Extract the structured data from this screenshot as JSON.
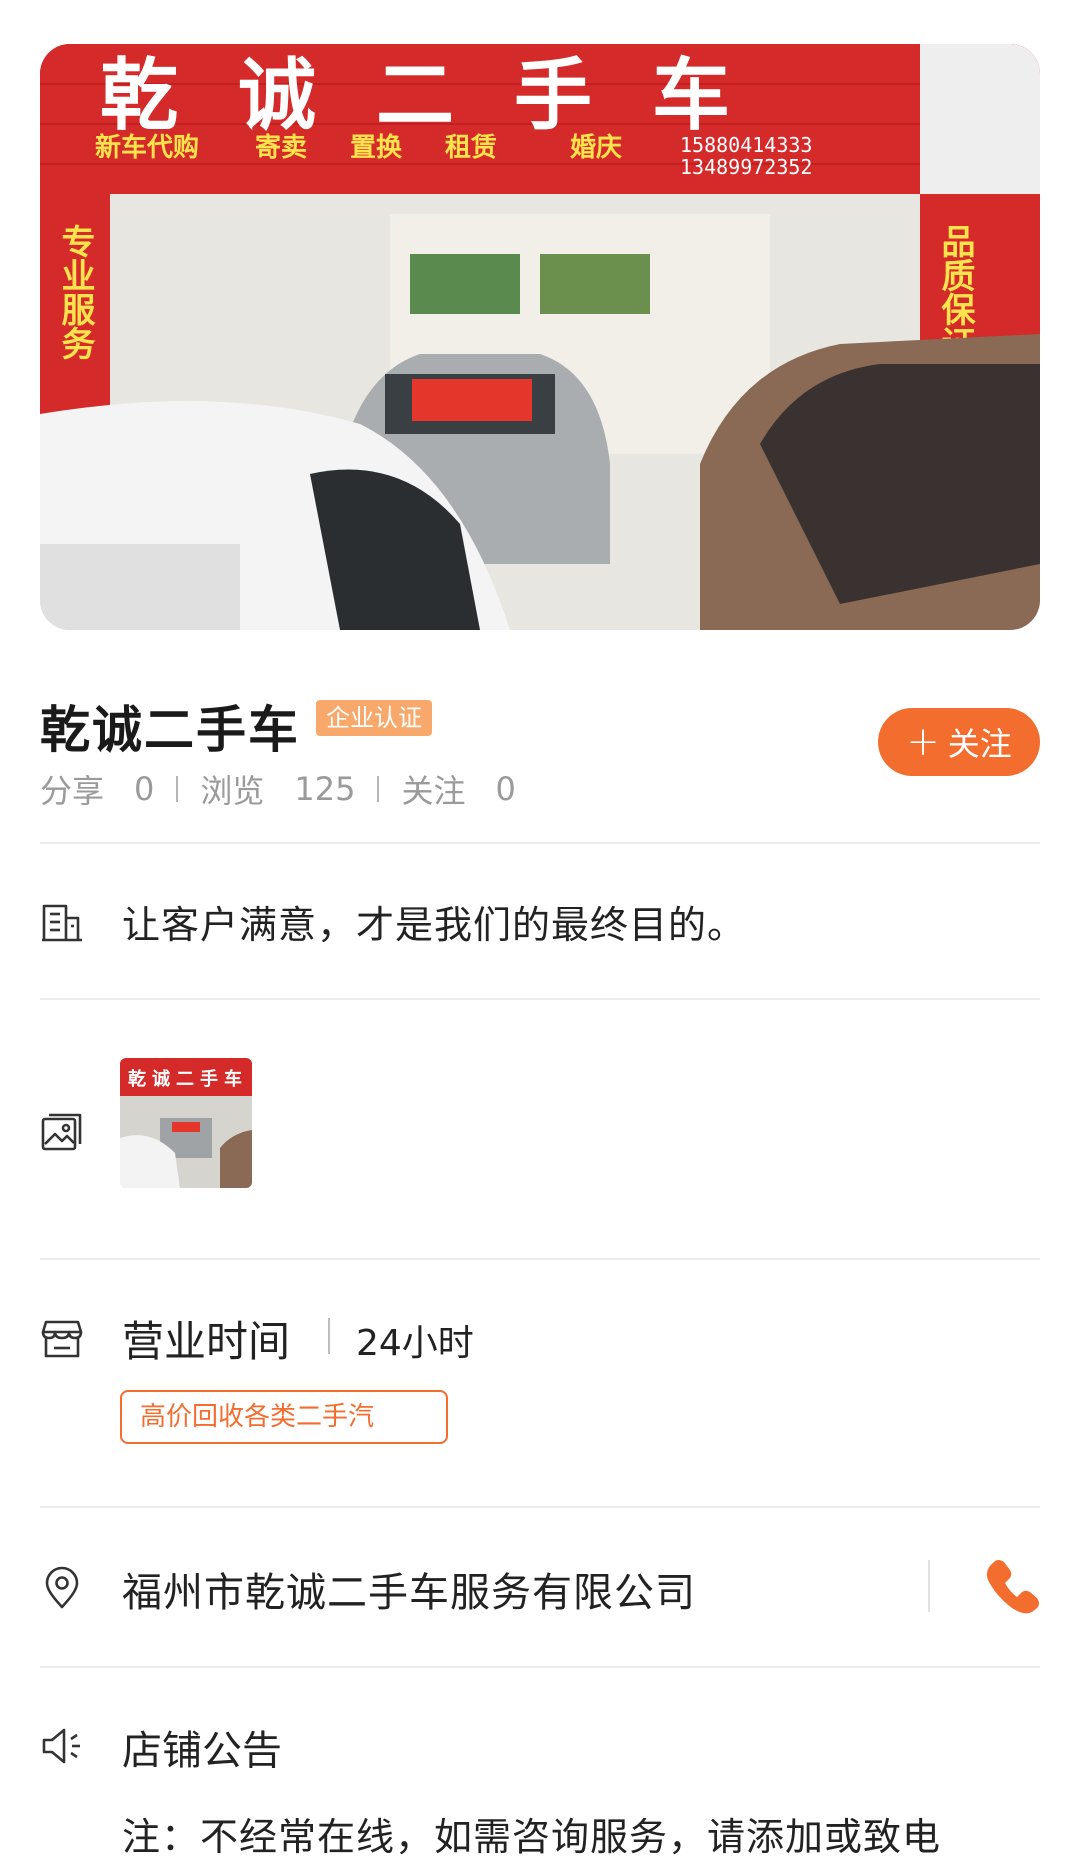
{
  "shop": {
    "name": "乾诚二手车",
    "cert_badge": "企业认证",
    "follow_label": "关注",
    "stats": {
      "share_label": "分享",
      "share_count": "0",
      "views_label": "浏览",
      "views_count": "125",
      "follow_label": "关注",
      "follow_count": "0"
    }
  },
  "hero_sign": {
    "title": "乾诚二手车",
    "services": [
      "新车代购",
      "寄卖",
      "置换",
      "租赁",
      "婚庆"
    ],
    "phones": [
      "15880414333",
      "13489972352"
    ],
    "left_banner": "专业服务",
    "right_banner": "品质保证"
  },
  "slogan": "让客户满意，才是我们的最终目的。",
  "thumb_sign": "乾诚二手车",
  "hours": {
    "label": "营业时间",
    "value": "24小时"
  },
  "tag": "高价回收各类二手汽",
  "address": "福州市乾诚二手车服务有限公司",
  "notice": {
    "title": "店铺公告",
    "text": "注：不经常在线，如需咨询服务，请添加或致电"
  },
  "colors": {
    "accent": "#f36d2f",
    "badge": "#f7a86a",
    "sign_red": "#d42a2a",
    "sign_yellow": "#ffe34d"
  },
  "icons": [
    "building-icon",
    "image-icon",
    "store-icon",
    "location-pin-icon",
    "phone-icon",
    "speaker-icon",
    "plus-icon"
  ]
}
